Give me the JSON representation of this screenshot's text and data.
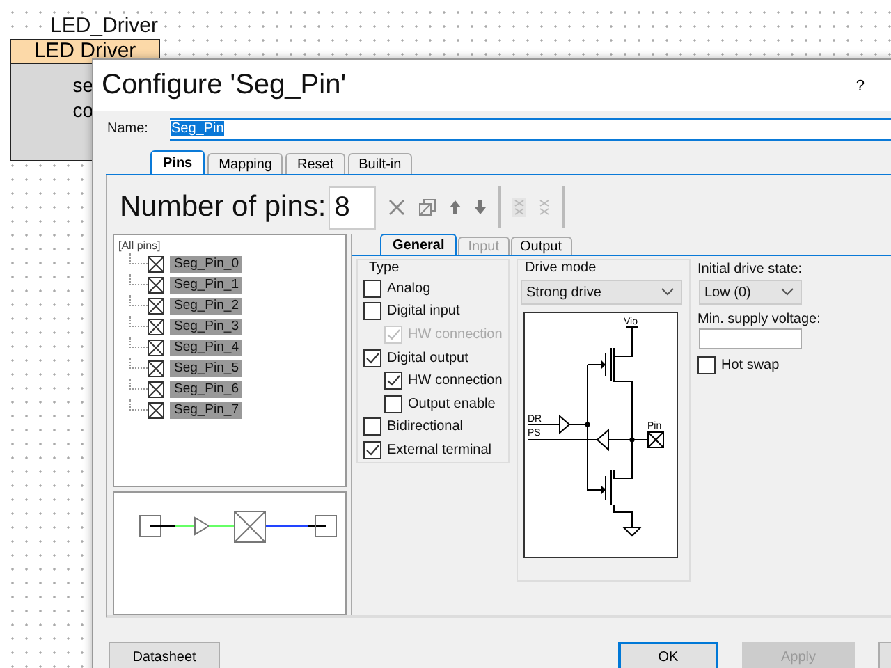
{
  "canvas": {
    "component": {
      "instance_name": "LED_Driver",
      "title": "LED Driver",
      "body_lines": [
        "se",
        "co"
      ]
    }
  },
  "dialog": {
    "title": "Configure 'Seg_Pin'",
    "help": "?",
    "name_label": "Name:",
    "name_value": "Seg_Pin",
    "tabs": [
      {
        "label": "Pins",
        "selected": true
      },
      {
        "label": "Mapping",
        "selected": false
      },
      {
        "label": "Reset",
        "selected": false
      },
      {
        "label": "Built-in",
        "selected": false
      }
    ],
    "pins_label": "Number of pins:",
    "pins_value": "8",
    "toolbar": [
      {
        "kind": "delete",
        "disabled": false
      },
      {
        "kind": "copy",
        "disabled": false
      },
      {
        "kind": "up",
        "disabled": false
      },
      {
        "kind": "down",
        "disabled": false
      },
      {
        "kind": "separator"
      },
      {
        "kind": "stack",
        "disabled": true
      },
      {
        "kind": "unstack",
        "disabled": true
      },
      {
        "kind": "separator"
      }
    ],
    "tree": {
      "label": "[All pins]",
      "children": [
        {
          "label": "Seg_Pin_0",
          "selected": true
        },
        {
          "label": "Seg_Pin_1",
          "selected": true
        },
        {
          "label": "Seg_Pin_2",
          "selected": true
        },
        {
          "label": "Seg_Pin_3",
          "selected": true
        },
        {
          "label": "Seg_Pin_4",
          "selected": true
        },
        {
          "label": "Seg_Pin_5",
          "selected": true
        },
        {
          "label": "Seg_Pin_6",
          "selected": true
        },
        {
          "label": "Seg_Pin_7",
          "selected": true
        }
      ]
    },
    "subtabs": [
      {
        "label": "General",
        "selected": true,
        "disabled": false
      },
      {
        "label": "Input",
        "selected": false,
        "disabled": true
      },
      {
        "label": "Output",
        "selected": false,
        "disabled": false
      }
    ],
    "type_group": {
      "title": "Type",
      "options": [
        {
          "label": "Analog",
          "checked": false,
          "disabled": false
        },
        {
          "label": "Digital input",
          "checked": false,
          "disabled": false,
          "children": [
            {
              "label": "HW connection",
              "checked": true,
              "disabled": true
            }
          ]
        },
        {
          "label": "Digital output",
          "checked": true,
          "disabled": false,
          "children": [
            {
              "label": "HW connection",
              "checked": true,
              "disabled": false
            },
            {
              "label": "Output enable",
              "checked": false,
              "disabled": false
            }
          ]
        },
        {
          "label": "Bidirectional",
          "checked": false,
          "disabled": false
        },
        {
          "label": "External terminal",
          "checked": true,
          "disabled": false
        }
      ]
    },
    "drive_mode": {
      "title": "Drive mode",
      "value": "Strong drive",
      "schematic_labels": {
        "supply": "Vio",
        "data": "DR",
        "port_state": "PS",
        "pin": "Pin"
      }
    },
    "initial_drive_state": {
      "label": "Initial drive state:",
      "value": "Low (0)"
    },
    "min_supply_voltage": {
      "label": "Min. supply voltage:"
    },
    "hot_swap": {
      "label": "Hot swap",
      "checked": false
    },
    "buttons": [
      {
        "label": "Datasheet",
        "default": false,
        "disabled": false
      },
      {
        "label": "OK",
        "default": true,
        "disabled": false
      },
      {
        "label": "Apply",
        "default": false,
        "disabled": true
      },
      {
        "default": false,
        "disabled": false
      }
    ]
  }
}
